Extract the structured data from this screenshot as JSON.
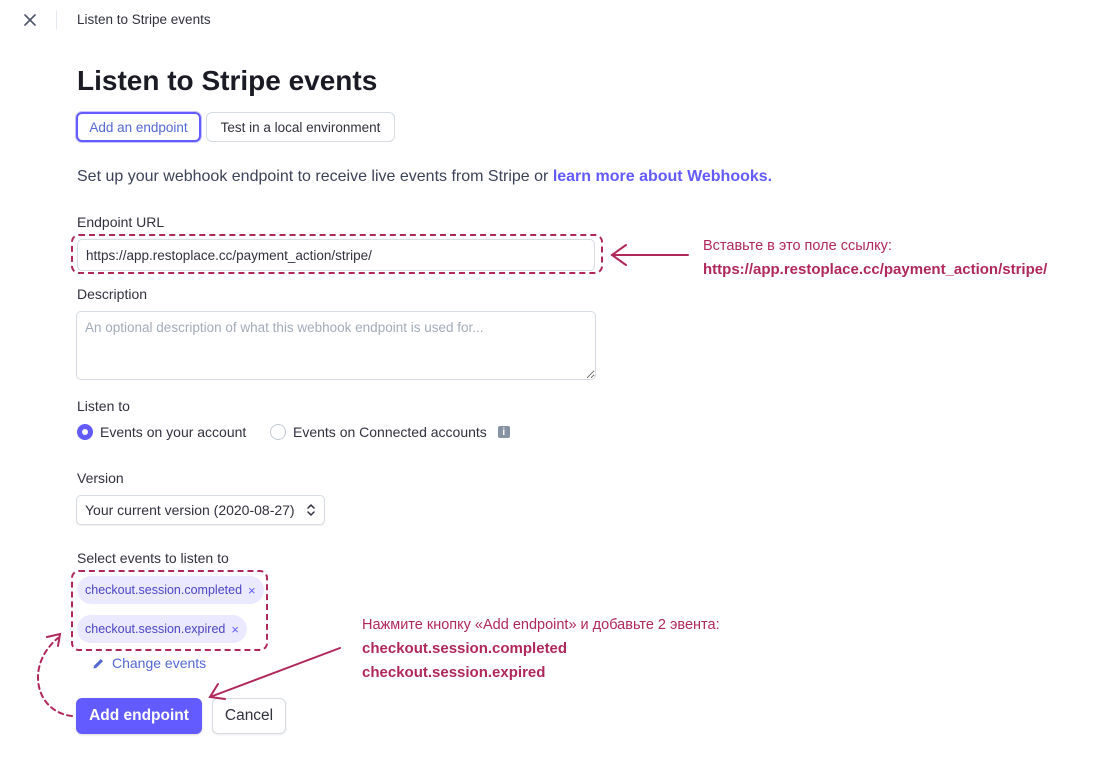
{
  "header": {
    "close_icon": "close-icon",
    "title": "Listen to Stripe events"
  },
  "page": {
    "title": "Listen to Stripe events",
    "tabs": [
      {
        "label": "Add an endpoint",
        "active": true
      },
      {
        "label": "Test in a local environment",
        "active": false
      }
    ],
    "intro_text": "Set up your webhook endpoint to receive live events from Stripe or ",
    "intro_link": "learn more about  Webhooks."
  },
  "form": {
    "endpoint_label": "Endpoint URL",
    "endpoint_value": "https://app.restoplace.cc/payment_action/stripe/",
    "description_label": "Description",
    "description_placeholder": "An optional description of what this webhook endpoint is used for...",
    "listen_label": "Listen to",
    "listen_options": [
      {
        "label": "Events on your account",
        "selected": true
      },
      {
        "label": "Events on Connected accounts",
        "selected": false
      }
    ],
    "version_label": "Version",
    "version_value": "Your current version (2020-08-27)",
    "events_label": "Select events to listen to",
    "events": [
      "checkout.session.completed",
      "checkout.session.expired"
    ],
    "change_events_label": "Change events",
    "submit_label": "Add endpoint",
    "cancel_label": "Cancel"
  },
  "annotations": {
    "url_note_line1": "Вставьте в это поле ссылку:",
    "url_note_line2": "https://app.restoplace.cc/payment_action/stripe/",
    "events_note_line1": "Нажмите кнопку «Add endpoint» и добавьте 2 эвента:",
    "events_note_line2": "checkout.session.completed",
    "events_note_line3": "checkout.session.expired"
  },
  "colors": {
    "accent": "#635bff",
    "annotation": "#b0285a",
    "chip_bg": "#ebe9ff"
  }
}
